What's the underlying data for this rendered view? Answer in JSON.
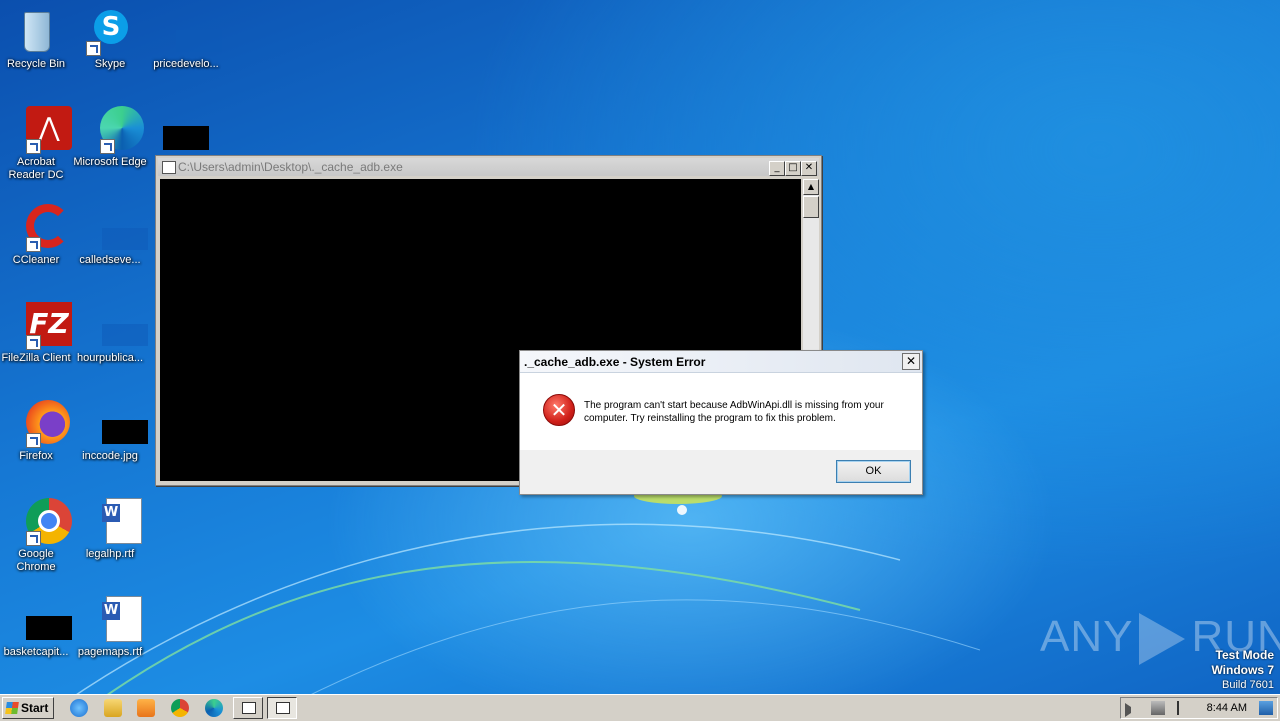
{
  "desktop": {
    "icons": [
      {
        "label": "Recycle Bin",
        "icon": "recycle-bin-icon"
      },
      {
        "label": "Skype",
        "icon": "skype-icon"
      },
      {
        "label": "pricedevelo...",
        "icon": "file-icon"
      },
      {
        "label": "Acrobat Reader DC",
        "icon": "acrobat-icon"
      },
      {
        "label": "Microsoft Edge",
        "icon": "edge-icon"
      },
      {
        "label": "CCleaner",
        "icon": "ccleaner-icon"
      },
      {
        "label": "calledseve...",
        "icon": "file-icon"
      },
      {
        "label": "FileZilla Client",
        "icon": "filezilla-icon"
      },
      {
        "label": "hourpublica...",
        "icon": "file-icon"
      },
      {
        "label": "Firefox",
        "icon": "firefox-icon"
      },
      {
        "label": "inccode.jpg",
        "icon": "image-file-icon"
      },
      {
        "label": "Google Chrome",
        "icon": "chrome-icon"
      },
      {
        "label": "legalhp.rtf",
        "icon": "word-doc-icon"
      },
      {
        "label": "basketcapit...",
        "icon": "file-icon"
      },
      {
        "label": "pagemaps.rtf",
        "icon": "word-doc-icon"
      }
    ]
  },
  "console_window": {
    "title": "C:\\Users\\admin\\Desktop\\._cache_adb.exe",
    "minimize": "_",
    "maximize": "□",
    "close": "✕"
  },
  "error_dialog": {
    "title": "._cache_adb.exe - System Error",
    "close": "✕",
    "icon_glyph": "✕",
    "message": "The program can't start because AdbWinApi.dll is missing from your computer. Try reinstalling the program to fix this problem.",
    "ok_label": "OK"
  },
  "taskbar": {
    "start_label": "Start",
    "clock": "8:44 AM"
  },
  "watermark": {
    "left": "ANY",
    "right": "RUN"
  },
  "system_text": {
    "line1": "Test Mode",
    "line2": "Windows 7",
    "line3": "Build 7601"
  }
}
